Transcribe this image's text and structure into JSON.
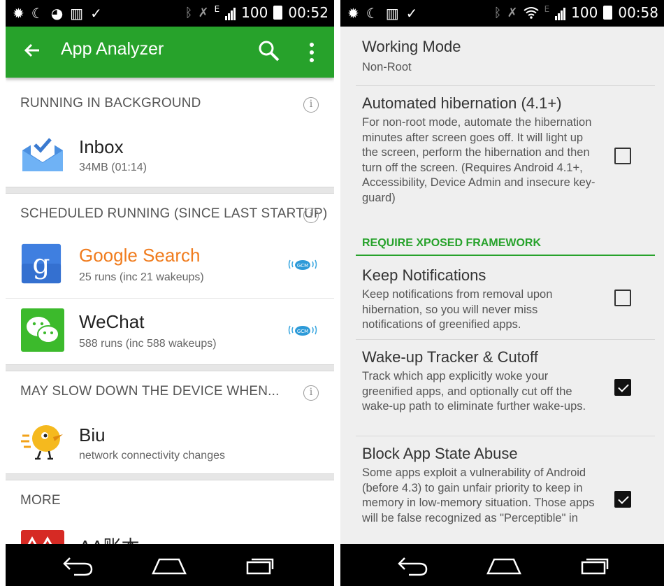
{
  "left": {
    "status": {
      "battery": "100",
      "time": "00:52",
      "network": "E"
    },
    "appbar": {
      "title": "App Analyzer"
    },
    "sections": [
      {
        "header": "RUNNING IN BACKGROUND"
      },
      {
        "header": "SCHEDULED RUNNING (SINCE LAST STARTUP)"
      },
      {
        "header": "MAY SLOW DOWN THE DEVICE WHEN..."
      },
      {
        "header": "MORE"
      }
    ],
    "apps": [
      {
        "name": "Inbox",
        "sub": "34MB (01:14)",
        "icon": "inbox-icon"
      },
      {
        "name": "Google Search",
        "sub": "25 runs (inc 21 wakeups)",
        "icon": "google-search-icon",
        "badge": "GCM",
        "name_color": "#f07c1e"
      },
      {
        "name": "WeChat",
        "sub": "588 runs (inc 588 wakeups)",
        "icon": "wechat-icon",
        "badge": "GCM"
      },
      {
        "name": "Biu",
        "sub": "network connectivity changes",
        "icon": "biu-icon"
      },
      {
        "name": "AA账本",
        "icon": "aa-icon"
      }
    ]
  },
  "right": {
    "status": {
      "battery": "100",
      "time": "00:58",
      "network": "E"
    },
    "prefs": [
      {
        "title": "Working Mode",
        "summary": "Non-Root"
      },
      {
        "title": "Automated hibernation (4.1+)",
        "summary": "For non-root mode, automate the hibernation minutes after screen goes off. It will light up the screen, perform the hibernation and then turn off the screen. (Requires Android 4.1+, Accessibility, Device Admin and insecure key-guard)",
        "checked": false
      },
      {
        "title": "Keep Notifications",
        "summary": "Keep notifications from removal upon hibernation, so you will never miss notifications of greenified apps.",
        "checked": false
      },
      {
        "title": "Wake-up Tracker & Cutoff",
        "summary": "Track which app explicitly woke your greenified apps, and optionally cut off the wake-up path to eliminate further wake-ups.",
        "checked": true
      },
      {
        "title": "Block App State Abuse",
        "summary": "Some apps exploit a vulnerability of Android (before 4.3) to gain unfair priority to keep in memory in low-memory situation. Those apps will be false recognized as \"Perceptible\" in",
        "checked": true
      }
    ],
    "category": "REQUIRE XPOSED FRAMEWORK"
  },
  "colors": {
    "accent": "#27a22b",
    "statusbar": "#000000",
    "google_orange": "#f07c1e"
  }
}
